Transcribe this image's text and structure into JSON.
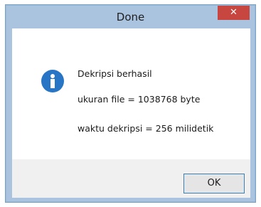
{
  "dialog": {
    "title": "Done",
    "close_label": "✕",
    "icon": "info-icon",
    "messages": [
      "Dekripsi berhasil",
      "ukuran file = 1038768 byte",
      "waktu dekripsi = 256 milidetik"
    ],
    "ok_label": "OK"
  },
  "colors": {
    "frame": "#aac4df",
    "close_button": "#c7463f",
    "info_icon": "#2775c4",
    "footer": "#f0f0f0",
    "ok_border": "#3c7fb1"
  }
}
